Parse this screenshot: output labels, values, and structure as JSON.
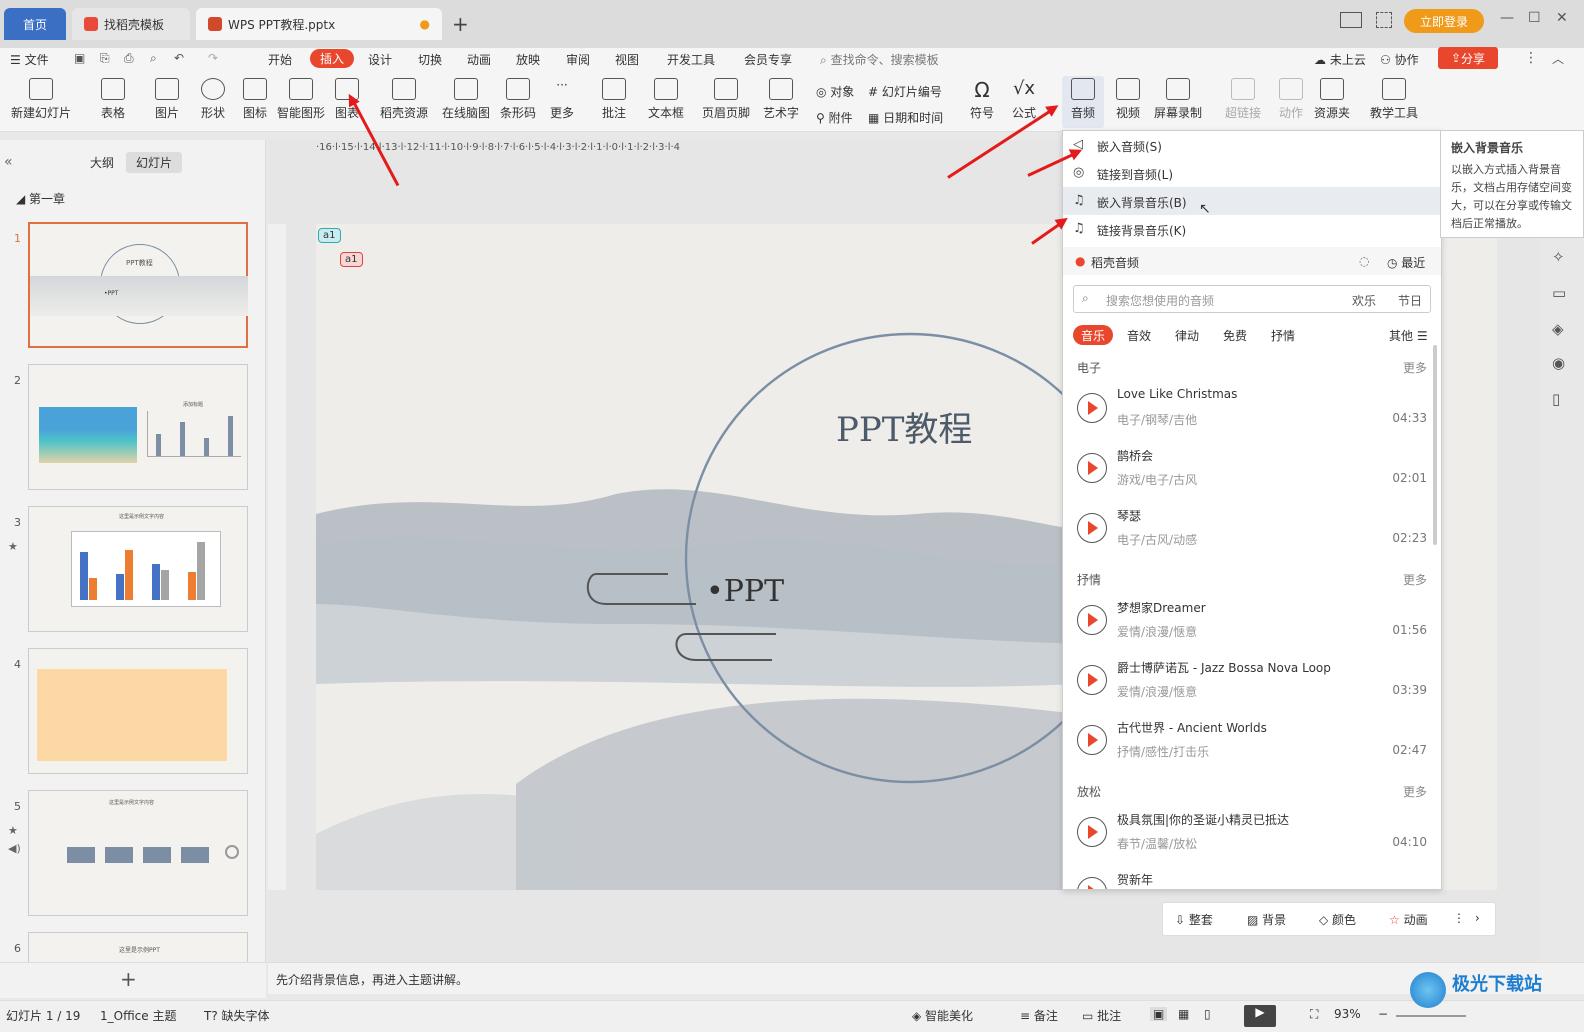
{
  "titlebar": {
    "tab_home": "首页",
    "tab_template": "找稻壳模板",
    "tab_doc": "WPS PPT教程.pptx",
    "new_tab": "+",
    "login": "立即登录"
  },
  "menubar": {
    "file": "文件",
    "items": [
      "开始",
      "插入",
      "设计",
      "切换",
      "动画",
      "放映",
      "审阅",
      "视图",
      "开发工具",
      "会员专享"
    ],
    "search_placeholder": "查找命令、搜索模板",
    "cloud": "未上云",
    "collab": "协作",
    "share": "分享"
  },
  "ribbon": {
    "new_slide": "新建幻灯片",
    "table": "表格",
    "picture": "图片",
    "shape": "形状",
    "icon": "图标",
    "smart_shape": "智能图形",
    "chart": "图表",
    "docer_resource": "稻壳资源",
    "mindmap": "在线脑图",
    "barcode": "条形码",
    "more": "更多",
    "comment": "批注",
    "textbox": "文本框",
    "header_footer": "页眉页脚",
    "wordart": "艺术字",
    "object": "对象",
    "slide_number": "幻灯片编号",
    "attachment": "附件",
    "datetime": "日期和时间",
    "symbol": "符号",
    "formula": "公式",
    "audio": "音频",
    "video": "视频",
    "screen_record": "屏幕录制",
    "hyperlink": "超链接",
    "action": "动作",
    "resource": "资源夹",
    "teaching": "教学工具"
  },
  "leftpanel": {
    "outline": "大纲",
    "slides": "幻灯片",
    "chapter": "第一章",
    "thumbs": [
      {
        "num": "1",
        "title": "PPT教程",
        "sub": "•PPT"
      },
      {
        "num": "2",
        "title": "添加标题"
      },
      {
        "num": "3",
        "title": "这里是示例文字内容"
      },
      {
        "num": "4",
        "title": ""
      },
      {
        "num": "5",
        "title": "这里是示例文字内容"
      },
      {
        "num": "6",
        "title": "这里是示例PPT"
      }
    ],
    "add": "+"
  },
  "ruler_text": "·16·l·15·l·14·l·13·l·12·l·11·l·10·l·9·l·8·l·7·l·6·l·5·l·4·l·3·l·2·l·1·l·0·l·1·l·2·l·3·l·4",
  "slide": {
    "title": "PPT教程",
    "subtitle": "•PPT",
    "comment1": "a1",
    "comment2": "a1"
  },
  "dropdown": {
    "embed_audio": "嵌入音频(S)",
    "link_audio": "链接到音频(L)",
    "embed_bg": "嵌入背景音乐(B)",
    "link_bg": "链接背景音乐(K)",
    "docer_audio": "稻壳音频",
    "recent": "最近",
    "search_placeholder": "搜索您想使用的音频",
    "tag1": "欢乐",
    "tag2": "节日",
    "tabs": [
      "音乐",
      "音效",
      "律动",
      "免费",
      "抒情"
    ],
    "other": "其他",
    "sections": [
      {
        "name": "电子",
        "more": "更多",
        "songs": [
          {
            "title": "Love Like Christmas",
            "tags": "电子/钢琴/吉他",
            "duration": "04:33"
          },
          {
            "title": "鹊桥会",
            "tags": "游戏/电子/古风",
            "duration": "02:01"
          },
          {
            "title": "琴瑟",
            "tags": "电子/古风/动感",
            "duration": "02:23"
          }
        ]
      },
      {
        "name": "抒情",
        "more": "更多",
        "songs": [
          {
            "title": "梦想家Dreamer",
            "tags": "爱情/浪漫/惬意",
            "duration": "01:56"
          },
          {
            "title": "爵士博萨诺瓦 - Jazz Bossa Nova Loop",
            "tags": "爱情/浪漫/惬意",
            "duration": "03:39"
          },
          {
            "title": "古代世界 - Ancient Worlds",
            "tags": "抒情/感性/打击乐",
            "duration": "02:47"
          }
        ]
      },
      {
        "name": "放松",
        "more": "更多",
        "songs": [
          {
            "title": "极具氛围|你的圣诞小精灵已抵达",
            "tags": "春节/温馨/放松",
            "duration": "04:10"
          },
          {
            "title": "贺新年",
            "tags": "",
            "duration": ""
          }
        ]
      }
    ]
  },
  "tooltip": {
    "title": "嵌入背景音乐",
    "body": "以嵌入方式插入背景音乐，文档占用存储空间变大，可以在分享或传输文档后正常播放。"
  },
  "quickbar": {
    "whole": "整套",
    "background": "背景",
    "color": "颜色",
    "animation": "动画"
  },
  "notes": "先介绍背景信息，再进入主题讲解。",
  "statusbar": {
    "slide_count": "幻灯片 1 / 19",
    "theme": "1_Office 主题",
    "missing_font": "缺失字体",
    "smart_beautify": "智能美化",
    "notes": "备注",
    "comment": "批注",
    "zoom": "93%"
  },
  "watermark": "极光下载站",
  "colors": {
    "accent": "#e9462e",
    "home_tab": "#3a6fc4",
    "login": "#f09a1a",
    "arrow": "#e31b1b"
  }
}
